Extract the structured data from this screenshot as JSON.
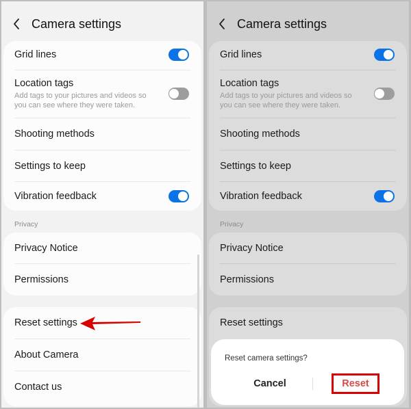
{
  "colors": {
    "accent": "#0b73e6",
    "annotation": "#d80000",
    "destructive": "#d84a4a"
  },
  "left": {
    "title": "Camera settings",
    "back_icon": "chevron-left-icon",
    "items": [
      {
        "label": "Grid lines",
        "toggle": "on"
      },
      {
        "label": "Location tags",
        "sub1": "Add tags to your pictures and videos so",
        "sub2": "you can see where they were taken.",
        "toggle": "off"
      },
      {
        "label": "Shooting methods"
      },
      {
        "label": "Settings to keep"
      },
      {
        "label": "Vibration feedback",
        "toggle": "on"
      }
    ],
    "privacy_section": "Privacy",
    "privacy_items": [
      {
        "label": "Privacy Notice"
      },
      {
        "label": "Permissions"
      }
    ],
    "bottom_items": [
      {
        "label": "Reset settings"
      },
      {
        "label": "About Camera"
      },
      {
        "label": "Contact us"
      }
    ],
    "annotation_icon": "red-arrow-icon"
  },
  "right": {
    "title": "Camera settings",
    "back_icon": "chevron-left-icon",
    "items": [
      {
        "label": "Grid lines",
        "toggle": "on"
      },
      {
        "label": "Location tags",
        "sub1": "Add tags to your pictures and videos so",
        "sub2": "you can see where they were taken.",
        "toggle": "off"
      },
      {
        "label": "Shooting methods"
      },
      {
        "label": "Settings to keep"
      },
      {
        "label": "Vibration feedback",
        "toggle": "on"
      }
    ],
    "privacy_section": "Privacy",
    "privacy_items": [
      {
        "label": "Privacy Notice"
      },
      {
        "label": "Permissions"
      }
    ],
    "bottom_items": [
      {
        "label": "Reset settings"
      }
    ],
    "dialog": {
      "question": "Reset camera settings?",
      "cancel_label": "Cancel",
      "reset_label": "Reset"
    }
  }
}
